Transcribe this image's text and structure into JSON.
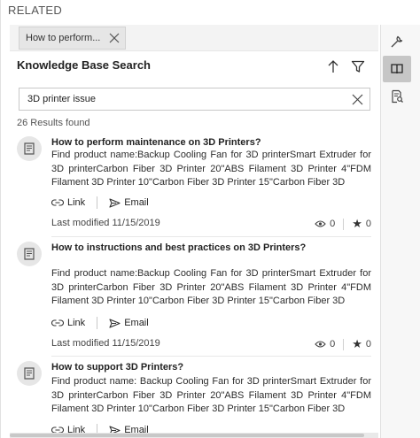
{
  "related": {
    "title": "RELATED"
  },
  "tab": {
    "label": "How to perform..."
  },
  "rail": {
    "items": [
      "wrench-icon",
      "book-icon",
      "document-search-icon"
    ],
    "active": "book-icon"
  },
  "kb": {
    "title": "Knowledge Base Search"
  },
  "search": {
    "value": "3D printer issue",
    "placeholder": ""
  },
  "results": {
    "count_text": "26 Results found",
    "items": [
      {
        "title": "How to perform maintenance on 3D Printers?",
        "snippet": "Find product name:Backup Cooling Fan for 3D printerSmart Extruder for 3D printerCarbon Fiber 3D Printer 20\"ABS Filament 3D Printer 4\"FDM Filament 3D Printer 10\"Carbon Fiber 3D Printer 15\"Carbon Fiber 3D",
        "link_label": "Link",
        "email_label": "Email",
        "modified": "Last modified 11/15/2019",
        "views": "0",
        "rating": "0"
      },
      {
        "title": "How to instructions and best practices on 3D Printers?",
        "snippet": "Find product name:Backup Cooling Fan for 3D printerSmart Extruder for 3D printerCarbon Fiber 3D Printer 20\"ABS Filament 3D Printer 4\"FDM Filament 3D Printer 10\"Carbon Fiber 3D Printer 15\"Carbon Fiber 3D",
        "link_label": "Link",
        "email_label": "Email",
        "modified": "Last modified 11/15/2019",
        "views": "0",
        "rating": "0"
      },
      {
        "title": "How to support 3D Printers?",
        "snippet": " Find product name: Backup Cooling Fan for 3D printerSmart Extruder for 3D printerCarbon Fiber 3D Printer 20\"ABS Filament 3D Printer 4\"FDM Filament 3D Printer 10\"Carbon Fiber 3D Printer 15\"Carbon Fiber 3D",
        "link_label": "Link",
        "email_label": "Email"
      }
    ]
  },
  "colors": {
    "accent": "#333333",
    "avatar_bg": "#e6e6e6",
    "active_rail": "#c6c6c6"
  }
}
